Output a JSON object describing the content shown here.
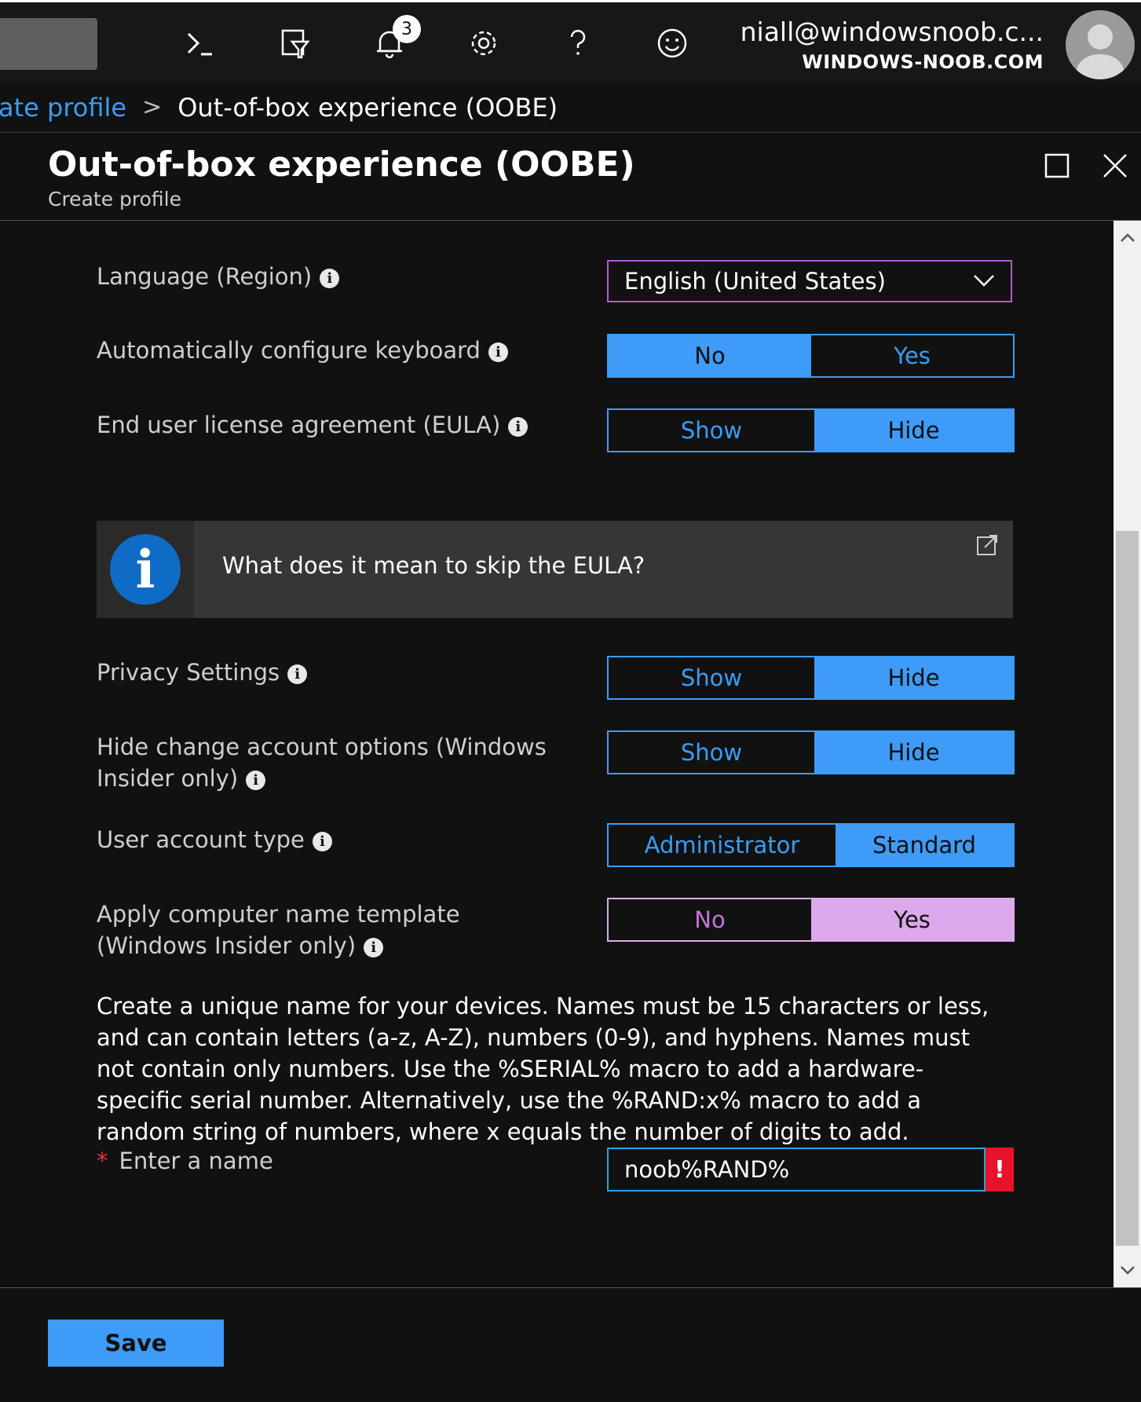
{
  "topbar": {
    "icons": [
      "cloud-shell-icon",
      "directory-filter-icon",
      "notifications-icon",
      "settings-icon",
      "help-icon",
      "feedback-icon"
    ],
    "notification_count": "3",
    "account_email": "niall@windowsnoob.c...",
    "account_org": "WINDOWS-NOOB.COM"
  },
  "breadcrumb": {
    "parent": "ate profile",
    "separator": ">",
    "current": "Out-of-box experience (OOBE)"
  },
  "blade": {
    "title": "Out-of-box experience (OOBE)",
    "subtitle": "Create profile"
  },
  "settings": {
    "language": {
      "label": "Language (Region)",
      "value": "English (United States)"
    },
    "keyboard": {
      "label": "Automatically configure keyboard",
      "options": [
        "No",
        "Yes"
      ],
      "selected": "No"
    },
    "eula": {
      "label": "End user license agreement (EULA)",
      "options": [
        "Show",
        "Hide"
      ],
      "selected": "Hide"
    },
    "eula_info": "What does it mean to skip the EULA?",
    "privacy": {
      "label": "Privacy Settings",
      "options": [
        "Show",
        "Hide"
      ],
      "selected": "Hide"
    },
    "change_account": {
      "label": "Hide change account options (Windows Insider only)",
      "options": [
        "Show",
        "Hide"
      ],
      "selected": "Hide"
    },
    "account_type": {
      "label": "User account type",
      "options": [
        "Administrator",
        "Standard"
      ],
      "selected": "Standard"
    },
    "name_template": {
      "label": "Apply computer name template (Windows Insider only)",
      "options": [
        "No",
        "Yes"
      ],
      "selected": "Yes"
    },
    "description": "Create a unique name for your devices. Names must be 15 characters or less, and can contain letters (a-z, A-Z), numbers (0-9), and hyphens. Names must not contain only numbers. Use the %SERIAL% macro to add a hardware-specific serial number. Alternatively, use the %RAND:x% macro to add a random string of numbers, where x equals the number of digits to add.",
    "name_field": {
      "required_mark": "*",
      "label": "Enter a name",
      "value": "noob%RAND%",
      "error_mark": "!"
    }
  },
  "footer": {
    "save_label": "Save"
  },
  "colors": {
    "accent": "#3f9bf8",
    "selected_pink": "#dca8eb",
    "error": "#e8132a",
    "background": "#111111"
  }
}
